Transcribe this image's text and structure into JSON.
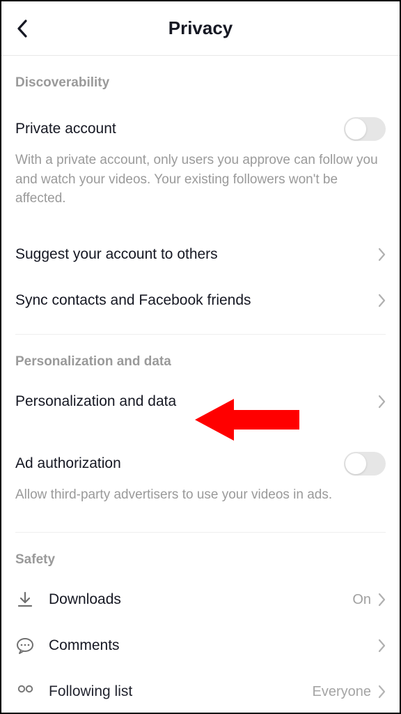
{
  "header": {
    "title": "Privacy"
  },
  "sections": {
    "discoverability": {
      "title": "Discoverability",
      "private_account": {
        "label": "Private account",
        "description": "With a private account, only users you approve can follow you and watch your videos. Your existing followers won't be affected.",
        "enabled": false
      },
      "suggest": {
        "label": "Suggest your account to others"
      },
      "sync": {
        "label": "Sync contacts and Facebook friends"
      }
    },
    "personalization": {
      "title": "Personalization and data",
      "data": {
        "label": "Personalization and data"
      },
      "ad_auth": {
        "label": "Ad authorization",
        "description": "Allow third-party advertisers to use your videos in ads.",
        "enabled": false
      }
    },
    "safety": {
      "title": "Safety",
      "downloads": {
        "label": "Downloads",
        "value": "On"
      },
      "comments": {
        "label": "Comments"
      },
      "following_list": {
        "label": "Following list",
        "value": "Everyone"
      }
    }
  },
  "colors": {
    "arrow": "#ff0000"
  }
}
